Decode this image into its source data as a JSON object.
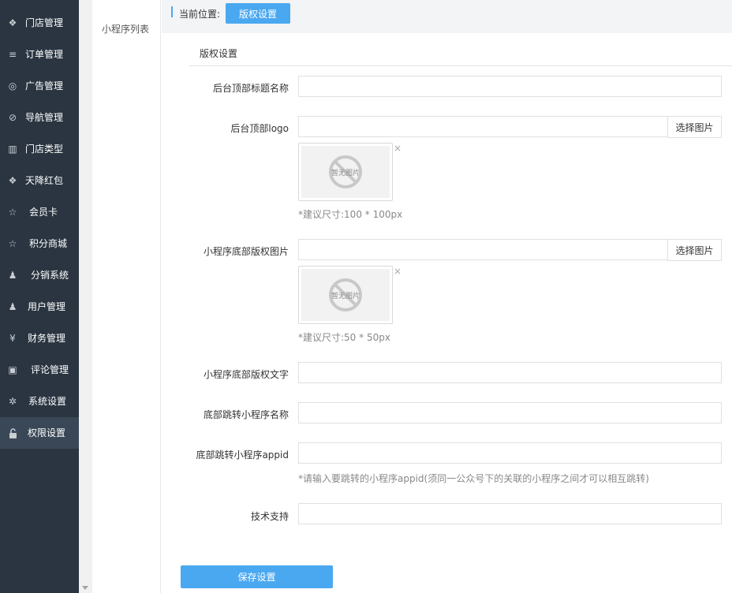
{
  "sidebar": {
    "items": [
      {
        "label": "门店管理",
        "icon": "stores-icon",
        "glyph": "❖"
      },
      {
        "label": "订单管理",
        "icon": "list-icon",
        "glyph": "≡"
      },
      {
        "label": "广告管理",
        "icon": "lifebuoy-icon",
        "glyph": "◎"
      },
      {
        "label": "导航管理",
        "icon": "compass-icon",
        "glyph": "⊘"
      },
      {
        "label": "门店类型",
        "icon": "bank-icon",
        "glyph": "▥"
      },
      {
        "label": "天降红包",
        "icon": "cubes-icon",
        "glyph": "❖"
      },
      {
        "label": "会员卡",
        "icon": "star-icon",
        "glyph": "☆"
      },
      {
        "label": "积分商城",
        "icon": "star-icon",
        "glyph": "☆"
      },
      {
        "label": "分销系统",
        "icon": "users-icon",
        "glyph": "♟"
      },
      {
        "label": "用户管理",
        "icon": "user-icon",
        "glyph": "♟"
      },
      {
        "label": "财务管理",
        "icon": "yen-icon",
        "glyph": "¥"
      },
      {
        "label": "评论管理",
        "icon": "money-icon",
        "glyph": "▣"
      },
      {
        "label": "系统设置",
        "icon": "gear-icon",
        "glyph": "✲"
      },
      {
        "label": "权限设置",
        "icon": "unlock-icon",
        "glyph": "🔓︎"
      }
    ],
    "active_index": 13
  },
  "subnav": {
    "item": "小程序列表"
  },
  "breadcrumb": {
    "label": "当前位置:",
    "current": "版权设置"
  },
  "panel": {
    "title": "版权设置"
  },
  "form": {
    "top_title_label": "后台顶部标题名称",
    "top_title_value": "",
    "top_logo_label": "后台顶部logo",
    "top_logo_value": "",
    "pick_image": "选择图片",
    "no_image": "暂无图片",
    "remove_glyph": "×",
    "logo_hint": "*建议尺寸:100 * 100px",
    "footer_img_label": "小程序底部版权图片",
    "footer_img_value": "",
    "footer_img_hint": "*建议尺寸:50 * 50px",
    "footer_text_label": "小程序底部版权文字",
    "footer_text_value": "",
    "jump_name_label": "底部跳转小程序名称",
    "jump_name_value": "",
    "jump_appid_label": "底部跳转小程序appid",
    "jump_appid_value": "",
    "jump_appid_hint": "*请输入要跳转的小程序appid(须同一公众号下的关联的小程序之间才可以相互跳转)",
    "support_label": "技术支持",
    "support_value": "",
    "save_label": "保存设置"
  }
}
